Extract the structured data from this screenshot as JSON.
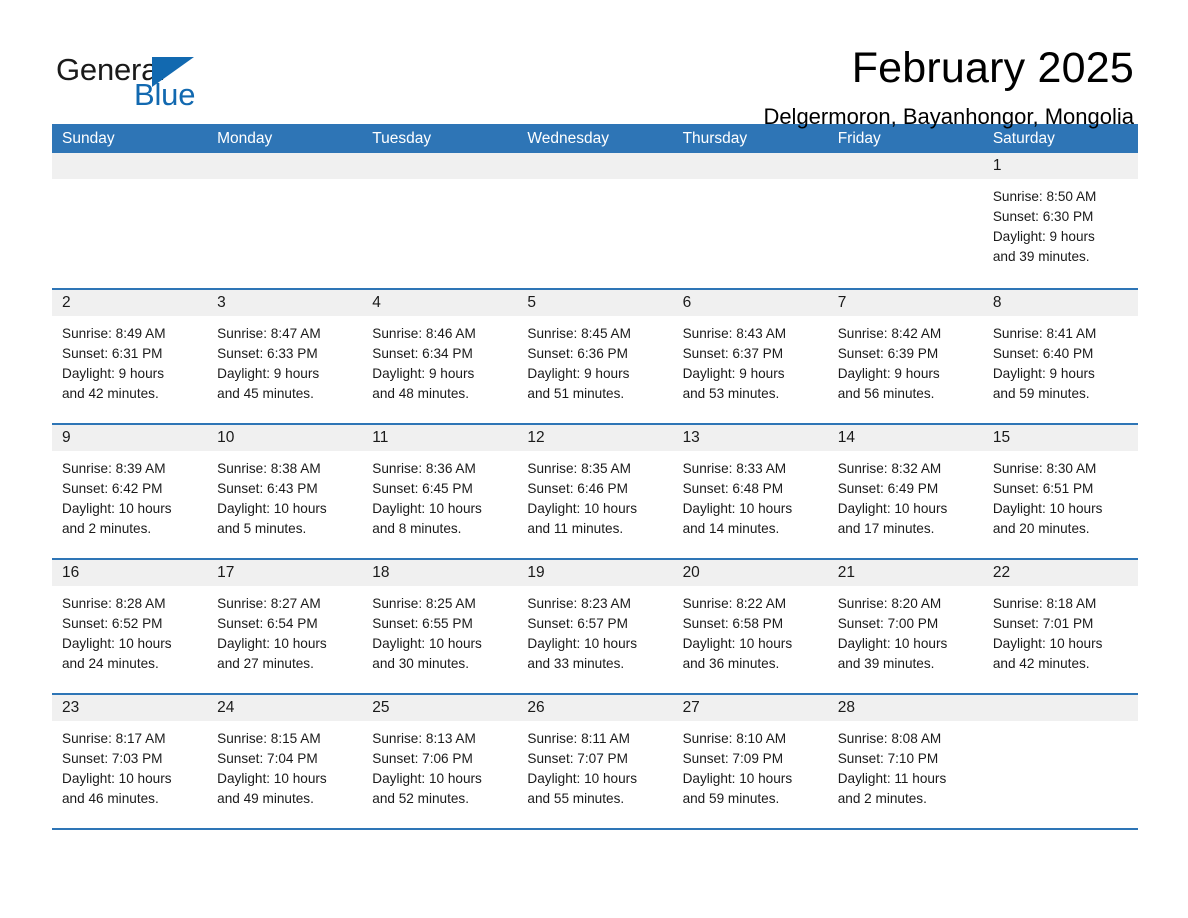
{
  "brand": {
    "name_part1": "General",
    "name_part2": "Blue",
    "logo_icon": "triangle-icon"
  },
  "header": {
    "month_title": "February 2025",
    "location": "Delgermoron, Bayanhongor, Mongolia"
  },
  "colors": {
    "header_blue": "#2e75b6",
    "brand_blue": "#1269b0",
    "daynum_band": "#f0f0f0",
    "text": "#1a1a1a"
  },
  "calendar": {
    "weekdays": [
      "Sunday",
      "Monday",
      "Tuesday",
      "Wednesday",
      "Thursday",
      "Friday",
      "Saturday"
    ],
    "weeks": [
      [
        {
          "day": "",
          "blank": true,
          "lines": []
        },
        {
          "day": "",
          "blank": true,
          "lines": []
        },
        {
          "day": "",
          "blank": true,
          "lines": []
        },
        {
          "day": "",
          "blank": true,
          "lines": []
        },
        {
          "day": "",
          "blank": true,
          "lines": []
        },
        {
          "day": "",
          "blank": true,
          "lines": []
        },
        {
          "day": "1",
          "blank": false,
          "lines": [
            "Sunrise: 8:50 AM",
            "Sunset: 6:30 PM",
            "Daylight: 9 hours",
            "and 39 minutes."
          ]
        }
      ],
      [
        {
          "day": "2",
          "blank": false,
          "lines": [
            "Sunrise: 8:49 AM",
            "Sunset: 6:31 PM",
            "Daylight: 9 hours",
            "and 42 minutes."
          ]
        },
        {
          "day": "3",
          "blank": false,
          "lines": [
            "Sunrise: 8:47 AM",
            "Sunset: 6:33 PM",
            "Daylight: 9 hours",
            "and 45 minutes."
          ]
        },
        {
          "day": "4",
          "blank": false,
          "lines": [
            "Sunrise: 8:46 AM",
            "Sunset: 6:34 PM",
            "Daylight: 9 hours",
            "and 48 minutes."
          ]
        },
        {
          "day": "5",
          "blank": false,
          "lines": [
            "Sunrise: 8:45 AM",
            "Sunset: 6:36 PM",
            "Daylight: 9 hours",
            "and 51 minutes."
          ]
        },
        {
          "day": "6",
          "blank": false,
          "lines": [
            "Sunrise: 8:43 AM",
            "Sunset: 6:37 PM",
            "Daylight: 9 hours",
            "and 53 minutes."
          ]
        },
        {
          "day": "7",
          "blank": false,
          "lines": [
            "Sunrise: 8:42 AM",
            "Sunset: 6:39 PM",
            "Daylight: 9 hours",
            "and 56 minutes."
          ]
        },
        {
          "day": "8",
          "blank": false,
          "lines": [
            "Sunrise: 8:41 AM",
            "Sunset: 6:40 PM",
            "Daylight: 9 hours",
            "and 59 minutes."
          ]
        }
      ],
      [
        {
          "day": "9",
          "blank": false,
          "lines": [
            "Sunrise: 8:39 AM",
            "Sunset: 6:42 PM",
            "Daylight: 10 hours",
            "and 2 minutes."
          ]
        },
        {
          "day": "10",
          "blank": false,
          "lines": [
            "Sunrise: 8:38 AM",
            "Sunset: 6:43 PM",
            "Daylight: 10 hours",
            "and 5 minutes."
          ]
        },
        {
          "day": "11",
          "blank": false,
          "lines": [
            "Sunrise: 8:36 AM",
            "Sunset: 6:45 PM",
            "Daylight: 10 hours",
            "and 8 minutes."
          ]
        },
        {
          "day": "12",
          "blank": false,
          "lines": [
            "Sunrise: 8:35 AM",
            "Sunset: 6:46 PM",
            "Daylight: 10 hours",
            "and 11 minutes."
          ]
        },
        {
          "day": "13",
          "blank": false,
          "lines": [
            "Sunrise: 8:33 AM",
            "Sunset: 6:48 PM",
            "Daylight: 10 hours",
            "and 14 minutes."
          ]
        },
        {
          "day": "14",
          "blank": false,
          "lines": [
            "Sunrise: 8:32 AM",
            "Sunset: 6:49 PM",
            "Daylight: 10 hours",
            "and 17 minutes."
          ]
        },
        {
          "day": "15",
          "blank": false,
          "lines": [
            "Sunrise: 8:30 AM",
            "Sunset: 6:51 PM",
            "Daylight: 10 hours",
            "and 20 minutes."
          ]
        }
      ],
      [
        {
          "day": "16",
          "blank": false,
          "lines": [
            "Sunrise: 8:28 AM",
            "Sunset: 6:52 PM",
            "Daylight: 10 hours",
            "and 24 minutes."
          ]
        },
        {
          "day": "17",
          "blank": false,
          "lines": [
            "Sunrise: 8:27 AM",
            "Sunset: 6:54 PM",
            "Daylight: 10 hours",
            "and 27 minutes."
          ]
        },
        {
          "day": "18",
          "blank": false,
          "lines": [
            "Sunrise: 8:25 AM",
            "Sunset: 6:55 PM",
            "Daylight: 10 hours",
            "and 30 minutes."
          ]
        },
        {
          "day": "19",
          "blank": false,
          "lines": [
            "Sunrise: 8:23 AM",
            "Sunset: 6:57 PM",
            "Daylight: 10 hours",
            "and 33 minutes."
          ]
        },
        {
          "day": "20",
          "blank": false,
          "lines": [
            "Sunrise: 8:22 AM",
            "Sunset: 6:58 PM",
            "Daylight: 10 hours",
            "and 36 minutes."
          ]
        },
        {
          "day": "21",
          "blank": false,
          "lines": [
            "Sunrise: 8:20 AM",
            "Sunset: 7:00 PM",
            "Daylight: 10 hours",
            "and 39 minutes."
          ]
        },
        {
          "day": "22",
          "blank": false,
          "lines": [
            "Sunrise: 8:18 AM",
            "Sunset: 7:01 PM",
            "Daylight: 10 hours",
            "and 42 minutes."
          ]
        }
      ],
      [
        {
          "day": "23",
          "blank": false,
          "lines": [
            "Sunrise: 8:17 AM",
            "Sunset: 7:03 PM",
            "Daylight: 10 hours",
            "and 46 minutes."
          ]
        },
        {
          "day": "24",
          "blank": false,
          "lines": [
            "Sunrise: 8:15 AM",
            "Sunset: 7:04 PM",
            "Daylight: 10 hours",
            "and 49 minutes."
          ]
        },
        {
          "day": "25",
          "blank": false,
          "lines": [
            "Sunrise: 8:13 AM",
            "Sunset: 7:06 PM",
            "Daylight: 10 hours",
            "and 52 minutes."
          ]
        },
        {
          "day": "26",
          "blank": false,
          "lines": [
            "Sunrise: 8:11 AM",
            "Sunset: 7:07 PM",
            "Daylight: 10 hours",
            "and 55 minutes."
          ]
        },
        {
          "day": "27",
          "blank": false,
          "lines": [
            "Sunrise: 8:10 AM",
            "Sunset: 7:09 PM",
            "Daylight: 10 hours",
            "and 59 minutes."
          ]
        },
        {
          "day": "28",
          "blank": false,
          "lines": [
            "Sunrise: 8:08 AM",
            "Sunset: 7:10 PM",
            "Daylight: 11 hours",
            "and 2 minutes."
          ]
        },
        {
          "day": "",
          "blank": true,
          "lines": []
        }
      ]
    ]
  }
}
